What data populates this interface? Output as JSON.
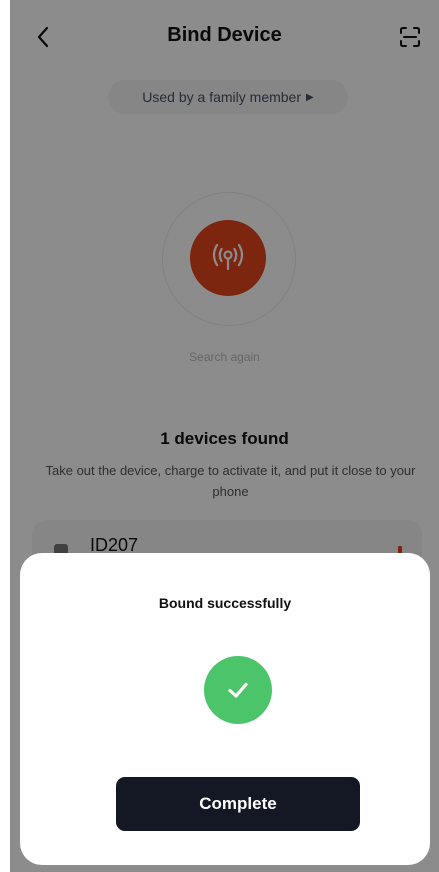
{
  "header": {
    "title": "Bind Device",
    "back_icon": "chevron-left-icon",
    "scan_icon": "scan-icon"
  },
  "family_pill": {
    "label": "Used by a family member",
    "arrow_icon": "caret-right-icon"
  },
  "search": {
    "icon": "antenna-icon",
    "again_label": "Search again"
  },
  "results": {
    "title": "1 devices found",
    "description": "Take out the device, charge to activate it, and put it close to your phone",
    "devices": [
      {
        "name": "ID207"
      }
    ]
  },
  "dialog": {
    "title": "Bound successfully",
    "status_icon": "check-icon",
    "button_label": "Complete"
  },
  "colors": {
    "accent": "#e2451d",
    "success": "#4cc46a",
    "button_dark": "#141724"
  }
}
